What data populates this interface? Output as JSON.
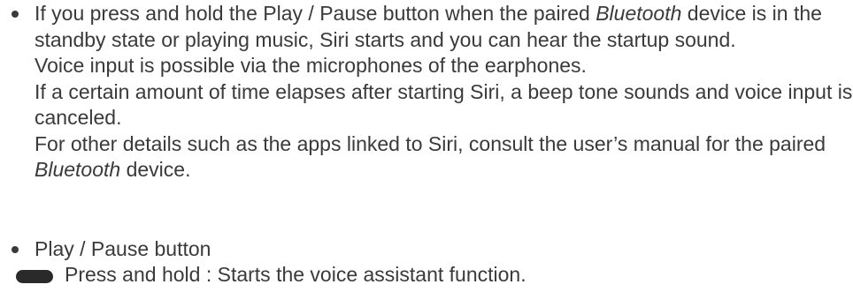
{
  "bullets": [
    {
      "paragraphs": [
        {
          "before": "If you press and hold the Play / Pause button when the paired ",
          "em": "Bluetooth",
          "after": " device is in the standby state or playing music, Siri starts and you can hear the startup sound."
        },
        {
          "before": "Voice input is possible via the microphones of the earphones."
        },
        {
          "before": "If a certain amount of time elapses after starting Siri, a beep tone sounds and voice input is canceled."
        },
        {
          "before": "For other details such as the apps linked to Siri, consult the user’s manual for the paired ",
          "em": "Bluetooth",
          "after": " device."
        }
      ]
    },
    {
      "heading": "Play / Pause button"
    }
  ],
  "press_action": {
    "icon": "press-and-hold-icon",
    "text": "Press and hold : Starts the voice assistant function."
  }
}
